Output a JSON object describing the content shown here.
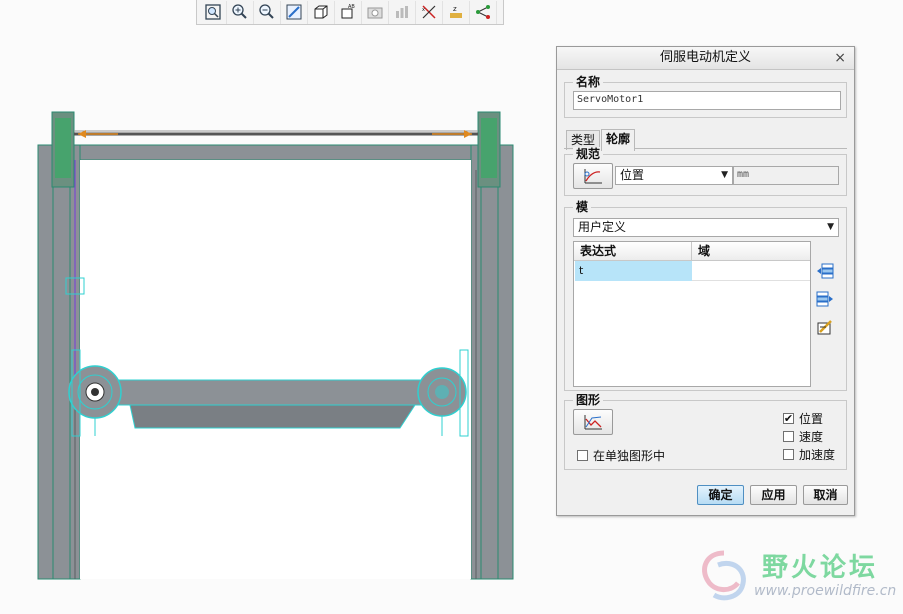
{
  "toolbar": {
    "icons": [
      "zoom-fit-icon",
      "zoom-in-icon",
      "zoom-out-icon",
      "repaint-icon",
      "view-orientation-icon",
      "saved-views-icon",
      "camera-icon",
      "display-style-icon",
      "datum-display-icon",
      "annotation-display-icon",
      "spin-center-icon"
    ]
  },
  "dialog": {
    "title": "伺服电动机定义",
    "close": "×",
    "name_label": "名称",
    "name_value": "ServoMotor1",
    "tabs": [
      "类型",
      "轮廓"
    ],
    "active_tab": "轮廓",
    "spec_label": "规范",
    "spec_select": "位置",
    "spec_unit": "mm",
    "mode_label": "模",
    "mode_select": "用户定义",
    "table_headers": [
      "表达式",
      "域"
    ],
    "table_rows": [
      {
        "expr": "t",
        "domain": ""
      }
    ],
    "graph_label": "图形",
    "graph_separate": "在单独图形中",
    "graph_separate_checked": false,
    "graph_options": [
      {
        "label": "位置",
        "checked": true
      },
      {
        "label": "速度",
        "checked": false
      },
      {
        "label": "加速度",
        "checked": false
      }
    ],
    "buttons": {
      "ok": "确定",
      "apply": "应用",
      "cancel": "取消"
    }
  },
  "watermark": {
    "text_cn": "野火论坛",
    "url": "www.proewildfire.cn"
  },
  "colors": {
    "accent": "#2fd0d0",
    "frame": "#2a8a70",
    "selection": "#b7e4f9"
  }
}
